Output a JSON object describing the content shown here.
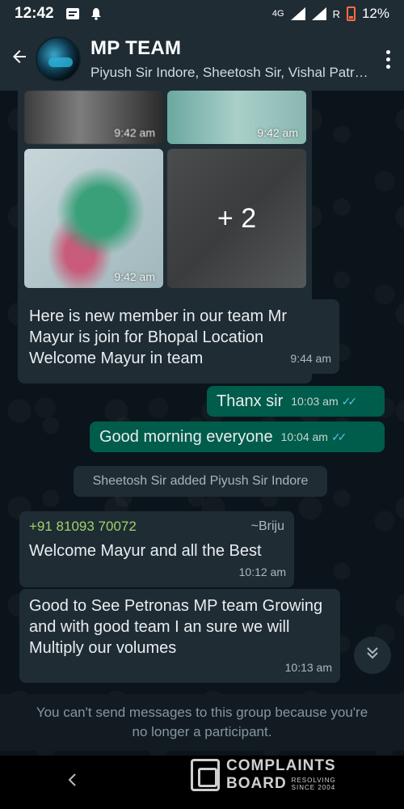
{
  "statusbar": {
    "time": "12:42",
    "network": "4G",
    "carrier_mark": "R",
    "battery": "12%"
  },
  "header": {
    "title": "MP TEAM",
    "subtitle": "Piyush Sir Indore, Sheetosh Sir, Vishal Patr…",
    "back_icon": "arrow-left-icon",
    "menu_icon": "more-vertical-icon"
  },
  "media": {
    "timestamps": [
      "9:42 am",
      "9:42 am",
      "9:42 am"
    ],
    "more_count": "+ 2"
  },
  "messages": [
    {
      "direction": "in",
      "text": "Here is new member in our team Mr Mayur is join for Bhopal Location Welcome Mayur in team",
      "time": "9:44 am"
    },
    {
      "direction": "out",
      "text": "Thanx sir",
      "time": "10:03 am",
      "status": "read"
    },
    {
      "direction": "out",
      "text": "Good morning everyone",
      "time": "10:04 am",
      "status": "read"
    },
    {
      "direction": "in",
      "sender_phone": "+91 81093 70072",
      "sender_name": "~Briju",
      "text": "Welcome Mayur and all the Best",
      "time": "10:12 am"
    },
    {
      "direction": "in",
      "text": "Good to See Petronas MP team Growing and with good team I an sure we will Multiply our volumes",
      "time": "10:13 am"
    }
  ],
  "system_message": "Sheetosh Sir added Piyush Sir Indore",
  "footer_note": "You can't send messages to this group because you're no longer a participant.",
  "watermark": {
    "line1": "COMPLAINTS",
    "line2": "BOARD",
    "small1": "RESOLVING",
    "small2": "SINCE 2004"
  },
  "colors": {
    "background": "#0b141a",
    "incoming_bubble": "#1f2c34",
    "outgoing_bubble": "#005c4b",
    "read_tick": "#53bdeb",
    "sender_phone": "#9fd36b"
  }
}
